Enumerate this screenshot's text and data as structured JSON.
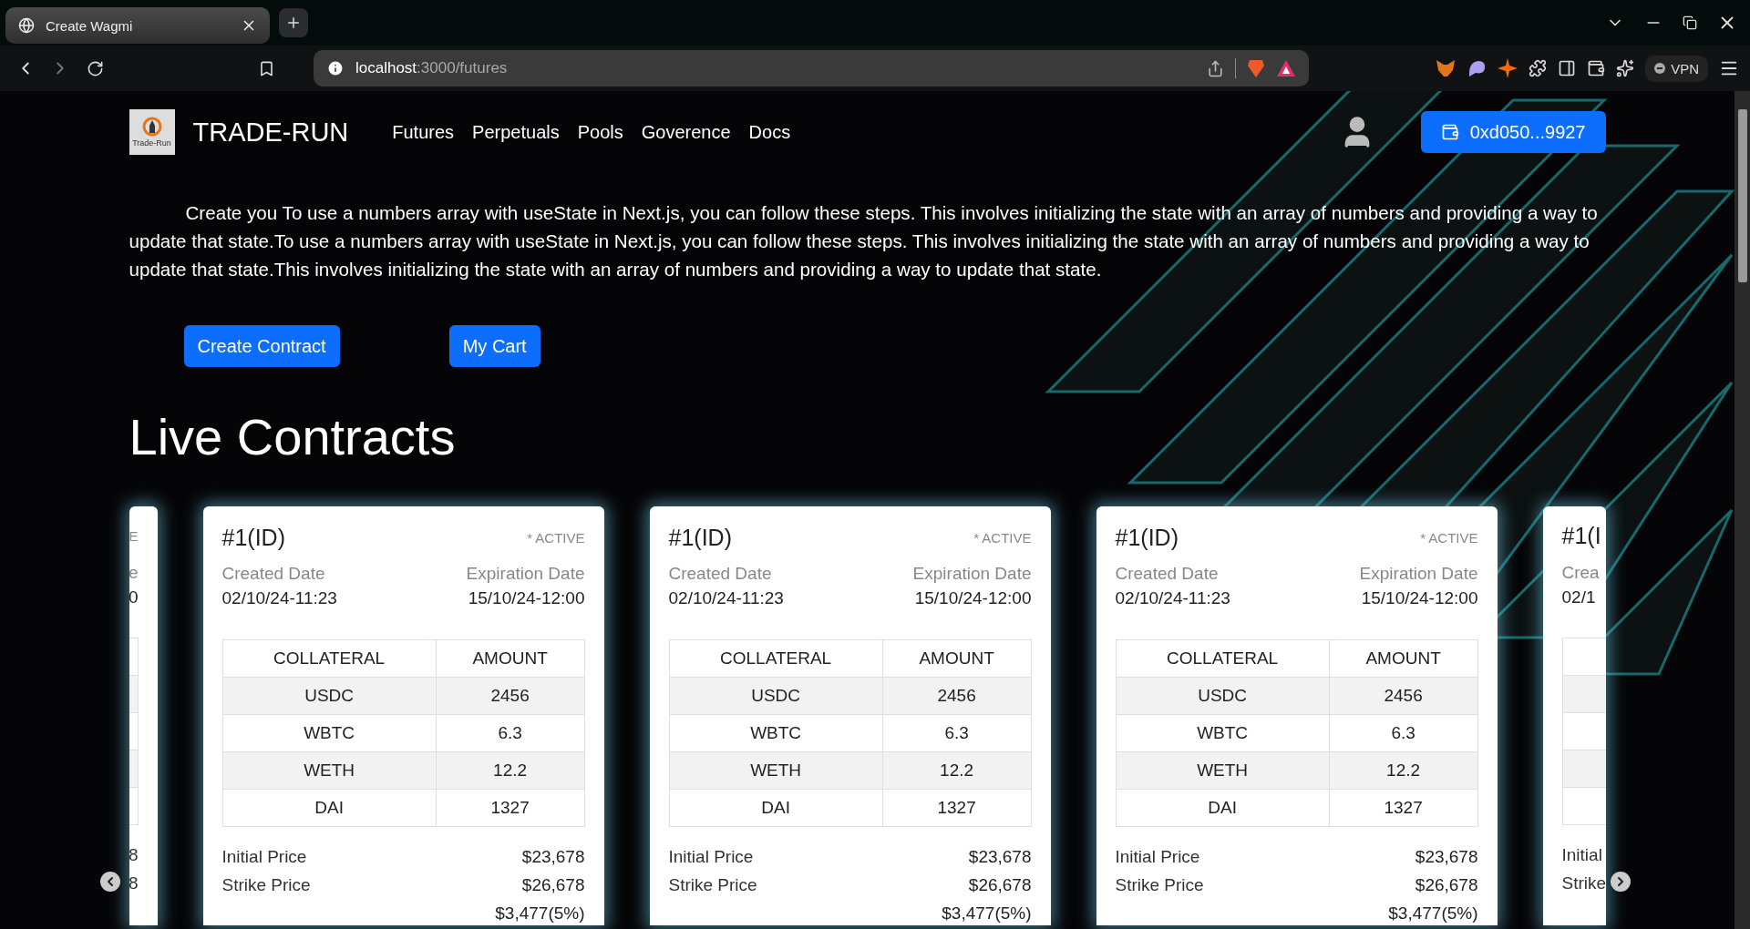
{
  "browser": {
    "tab": {
      "title": "Create Wagmi"
    },
    "address": {
      "host": "localhost",
      "path": ":3000/futures"
    },
    "vpn": "VPN"
  },
  "nav": {
    "logo_caption": "Trade-Run",
    "brand": "TRADE-RUN",
    "links": [
      "Futures",
      "Perpetuals",
      "Pools",
      "Goverence",
      "Docs"
    ],
    "wallet": "0xd050...9927"
  },
  "intro": "Create you To use a numbers array with useState in Next.js, you can follow these steps. This involves initializing the state with an array of numbers and providing a way to update that state.To use a numbers array with useState in Next.js, you can follow these steps. This involves initializing the state with an array of numbers and providing a way to update that state.This involves initializing the state with an array of numbers and providing a way to update that state.",
  "actions": [
    "Create Contract",
    "My Cart"
  ],
  "heading": "Live Contracts",
  "cards": [
    {
      "kind": "partial-left",
      "status": "E",
      "created_label": "e",
      "created": "0",
      "initial": "8",
      "strike": "8"
    },
    {
      "kind": "full",
      "id": "#1(ID)",
      "status": "* ACTIVE",
      "created_label": "Created Date",
      "created": "02/10/24-11:23",
      "expiration_label": "Expiration Date",
      "expiration": "15/10/24-12:00",
      "columns": [
        "COLLATERAL",
        "AMOUNT"
      ],
      "rows": [
        [
          "USDC",
          "2456"
        ],
        [
          "WBTC",
          "6.3"
        ],
        [
          "WETH",
          "12.2"
        ],
        [
          "DAI",
          "1327"
        ]
      ],
      "prices": [
        {
          "label": "Initial Price",
          "value": "$23,678"
        },
        {
          "label": "Strike Price",
          "value": "$26,678"
        }
      ],
      "change": "$3,477(5%)"
    },
    {
      "kind": "full",
      "id": "#1(ID)",
      "status": "* ACTIVE",
      "created_label": "Created Date",
      "created": "02/10/24-11:23",
      "expiration_label": "Expiration Date",
      "expiration": "15/10/24-12:00",
      "columns": [
        "COLLATERAL",
        "AMOUNT"
      ],
      "rows": [
        [
          "USDC",
          "2456"
        ],
        [
          "WBTC",
          "6.3"
        ],
        [
          "WETH",
          "12.2"
        ],
        [
          "DAI",
          "1327"
        ]
      ],
      "prices": [
        {
          "label": "Initial Price",
          "value": "$23,678"
        },
        {
          "label": "Strike Price",
          "value": "$26,678"
        }
      ],
      "change": "$3,477(5%)"
    },
    {
      "kind": "full",
      "id": "#1(ID)",
      "status": "* ACTIVE",
      "created_label": "Created Date",
      "created": "02/10/24-11:23",
      "expiration_label": "Expiration Date",
      "expiration": "15/10/24-12:00",
      "columns": [
        "COLLATERAL",
        "AMOUNT"
      ],
      "rows": [
        [
          "USDC",
          "2456"
        ],
        [
          "WBTC",
          "6.3"
        ],
        [
          "WETH",
          "12.2"
        ],
        [
          "DAI",
          "1327"
        ]
      ],
      "prices": [
        {
          "label": "Initial Price",
          "value": "$23,678"
        },
        {
          "label": "Strike Price",
          "value": "$26,678"
        }
      ],
      "change": "$3,477(5%)"
    },
    {
      "kind": "partial-right",
      "id": "#1(I",
      "created_label": "Crea",
      "created": "02/1",
      "initial": "Initial",
      "strike": "Strike"
    }
  ]
}
